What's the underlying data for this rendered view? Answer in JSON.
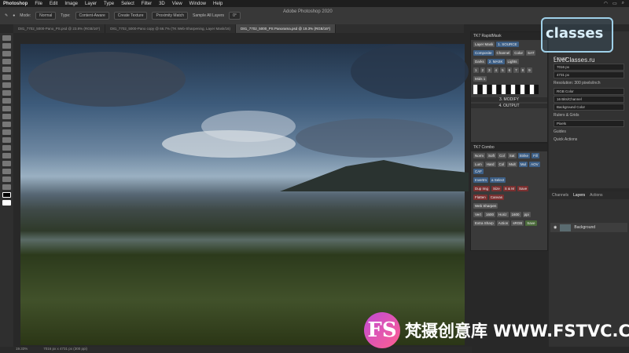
{
  "menubar": {
    "app": "Photoshop",
    "items": [
      "File",
      "Edit",
      "Image",
      "Layer",
      "Type",
      "Select",
      "Filter",
      "3D",
      "View",
      "Window",
      "Help"
    ]
  },
  "window": {
    "title": "Adobe Photoshop 2020"
  },
  "options": {
    "mode_label": "Mode:",
    "mode_value": "Normal",
    "type_label": "Type:",
    "type_value": "Content-Aware",
    "create_texture": "Create Texture",
    "proximity_match": "Proximity Match",
    "sample_all_layers": "Sample All Layers",
    "angle": "0°"
  },
  "tabs": [
    "D81_7702_5000-Pano_PS.psd @ 23.8% (RGB/16*)",
    "D81_7702_5000-Pano copy @ 66.7% (TK Web-Sharpening, Layer Mask/16)",
    "D81_7702_5000_PS Panorama.psd @ 19.3% (RGB/16*)"
  ],
  "status": {
    "zoom": "19.33%",
    "doc": "7016 px x 4731 px (300 ppi)"
  },
  "rapidmask": {
    "title": "TK7 RapidMask",
    "layer_mask": "Layer Mask",
    "source_label": "1. SOURCE",
    "tabs": [
      "Composite",
      "Channel",
      "Color",
      "SAT"
    ],
    "mask_label": "2. MASK",
    "mask_darks": "Darks",
    "mask_lights": "Lights",
    "numbers": [
      "1",
      "2",
      "3",
      "4",
      "5",
      "6",
      "7",
      "8",
      "9"
    ],
    "modify_label": "3. MODIFY",
    "output_label": "4. OUTPUT",
    "mids": "Mids 1"
  },
  "combo": {
    "title": "TK7 Combo",
    "row1": [
      "Norm",
      "Soft",
      "Col",
      "Sat"
    ],
    "row2": [
      "Lum",
      "Hard",
      "Col",
      "Mult"
    ],
    "row3": [
      "Dup Img",
      "Size"
    ],
    "row4": [
      "Flatten",
      "Canvas"
    ],
    "right1": [
      "Strike",
      "Fill"
    ],
    "right2": [
      "Mul",
      "AOV",
      "CAF"
    ],
    "right3": [
      "Invertm",
      "a Select"
    ],
    "right4": [
      "S & M",
      "Save"
    ],
    "web_sharpen": "Web Sharpen",
    "vert": "Vert",
    "vert_val": "1600",
    "horiz": "Horiz",
    "horiz_val": "1600",
    "ppi": "ppi",
    "extra_sharp": "Extra Sharp",
    "action": "Action",
    "srgb": "sRGB",
    "save": "Save"
  },
  "properties": {
    "canvas_label": "Canvas",
    "w": "7016 px",
    "h": "4731 px",
    "resolution": "Resolution: 300 pixels/inch",
    "mode": "RGB Color",
    "bits": "16 Bits/Channel",
    "fill": "Background Color",
    "rulers": "Rulers & Grids",
    "pixels": "Pixels",
    "guides": "Guides",
    "quick_actions": "Quick Actions"
  },
  "logo": {
    "brand": "classes",
    "site": "LiveClasses.ru"
  },
  "layers": {
    "tabs": [
      "Channels",
      "Layers",
      "Actions"
    ],
    "layer_name": "Background"
  },
  "watermark": {
    "badge": "FS",
    "text": "梵摄创意库 WWW.FSTVC.CC"
  }
}
